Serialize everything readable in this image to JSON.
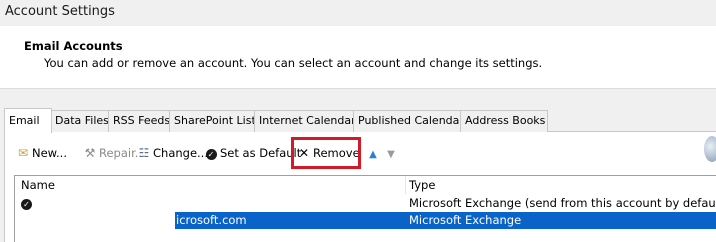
{
  "window": {
    "title": "Account Settings"
  },
  "header": {
    "title": "Email Accounts",
    "description": "You can add or remove an account. You can select an account and change its settings."
  },
  "tabs": [
    {
      "label": "Email",
      "active": true
    },
    {
      "label": "Data Files"
    },
    {
      "label": "RSS Feeds"
    },
    {
      "label": "SharePoint Lists"
    },
    {
      "label": "Internet Calendars"
    },
    {
      "label": "Published Calendars"
    },
    {
      "label": "Address Books"
    }
  ],
  "toolbar": {
    "new_label": "New...",
    "repair_label": "Repair...",
    "change_label": "Change...",
    "set_default_label": "Set as Default",
    "remove_label": "Remove"
  },
  "list": {
    "columns": [
      "Name",
      "Type"
    ],
    "rows": [
      {
        "name": "",
        "type": "Microsoft Exchange (send from this account by default)",
        "default": true,
        "selected": false
      },
      {
        "name": "icrosoft.com",
        "type": "Microsoft Exchange",
        "default": false,
        "selected": true
      }
    ]
  },
  "colors": {
    "selection": "#0a63c9",
    "highlight_box": "#d11a2a"
  }
}
